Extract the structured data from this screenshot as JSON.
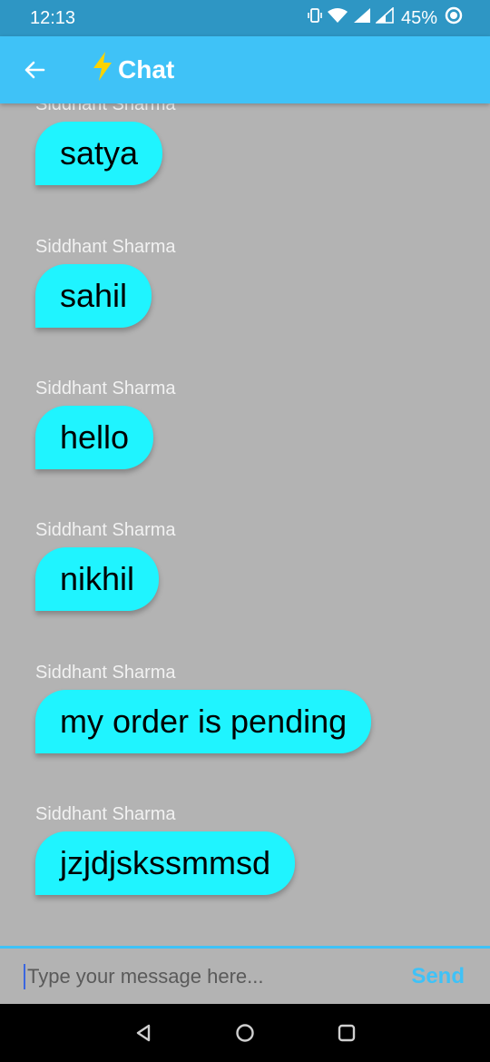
{
  "status_bar": {
    "time": "12:13",
    "battery": "45%"
  },
  "app_bar": {
    "title": "Chat"
  },
  "messages": [
    {
      "sender": "Siddhant Sharma",
      "text": "satya"
    },
    {
      "sender": "Siddhant Sharma",
      "text": "sahil"
    },
    {
      "sender": "Siddhant Sharma",
      "text": "hello"
    },
    {
      "sender": "Siddhant Sharma",
      "text": "nikhil"
    },
    {
      "sender": "Siddhant Sharma",
      "text": "my order is pending"
    },
    {
      "sender": "Siddhant Sharma",
      "text": "jzjdjskssmmsd"
    }
  ],
  "composer": {
    "placeholder": "Type your message here...",
    "value": "",
    "send_label": "Send"
  },
  "icons": [
    "vibrate-icon",
    "wifi-icon",
    "signal-icon",
    "battery-icon",
    "back-arrow-icon",
    "lightning-icon",
    "nav-back-icon",
    "nav-home-icon",
    "nav-recents-icon"
  ],
  "colors": {
    "status_bar": "#2e96c4",
    "app_bar": "#3fc2f7",
    "bubble": "#1ff4ff",
    "background": "#b3b3b3",
    "bolt": "#fbd300"
  }
}
